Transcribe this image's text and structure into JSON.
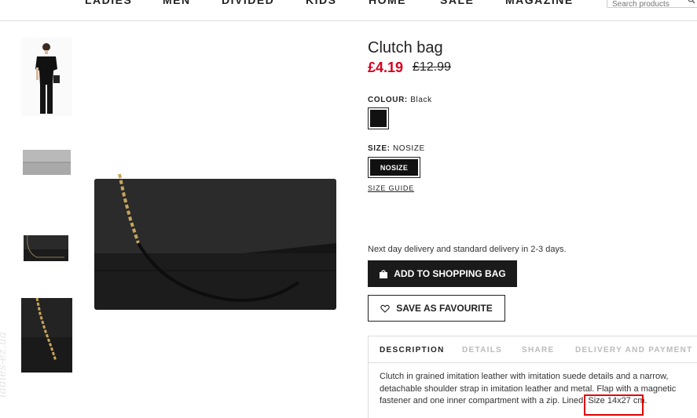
{
  "nav": {
    "items": [
      "LADIES",
      "MEN",
      "DIVIDED",
      "KIDS",
      "HOME",
      "SALE",
      "MAGAZINE"
    ],
    "search_placeholder": "Search products"
  },
  "product": {
    "title": "Clutch bag",
    "price": "£4.19",
    "old_price": "£12.99",
    "colour_label": "COLOUR:",
    "colour_value": "Black",
    "colour_swatch": "#111111",
    "size_label": "SIZE:",
    "size_value": "NOSIZE",
    "size_option": "NOSIZE",
    "size_guide": "SIZE GUIDE",
    "delivery_note": "Next day delivery and standard delivery in 2-3 days.",
    "add_button": "ADD TO SHOPPING BAG",
    "fav_button": "SAVE AS FAVOURITE"
  },
  "tabs": [
    "DESCRIPTION",
    "DETAILS",
    "SHARE",
    "DELIVERY AND PAYMENT"
  ],
  "description": {
    "text": "Clutch in grained imitation leather with imitation suede details and a narrow, detachable shoulder strap in imitation leather and metal. Flap with a magnetic fastener and one inner compartment with a zip. Lined. Size 14x27 cm."
  },
  "watermark": "ladies-ez.ua",
  "colors": {
    "price_red": "#d6001c",
    "highlight": "#e00000"
  }
}
